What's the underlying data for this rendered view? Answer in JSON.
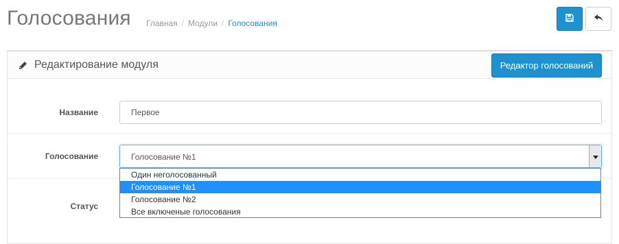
{
  "header": {
    "title": "Голосования",
    "breadcrumb": [
      {
        "label": "Главная"
      },
      {
        "label": "Модули"
      },
      {
        "label": "Голосования"
      }
    ],
    "separator": "/",
    "save_icon": "floppy-disk-icon",
    "back_icon": "reply-arrow-icon"
  },
  "panel": {
    "title": "Редактирование модуля",
    "title_icon": "pencil-icon",
    "editor_button_label": "Редактор голосований"
  },
  "form": {
    "name": {
      "label": "Название",
      "value": "Первое"
    },
    "vote": {
      "label": "Голосование",
      "selected": "Голосование №1",
      "options": [
        "Один неголосованный",
        "Голосование №1",
        "Голосование №2",
        "Все включеные голосования"
      ],
      "selected_index": 1,
      "arrow_icon": "triangle-down-icon"
    },
    "status": {
      "label": "Статус"
    }
  },
  "colors": {
    "primary": "#1e91cf",
    "dropdown_highlight": "#1e90ff",
    "breadcrumb_active": "#1e91cf"
  }
}
